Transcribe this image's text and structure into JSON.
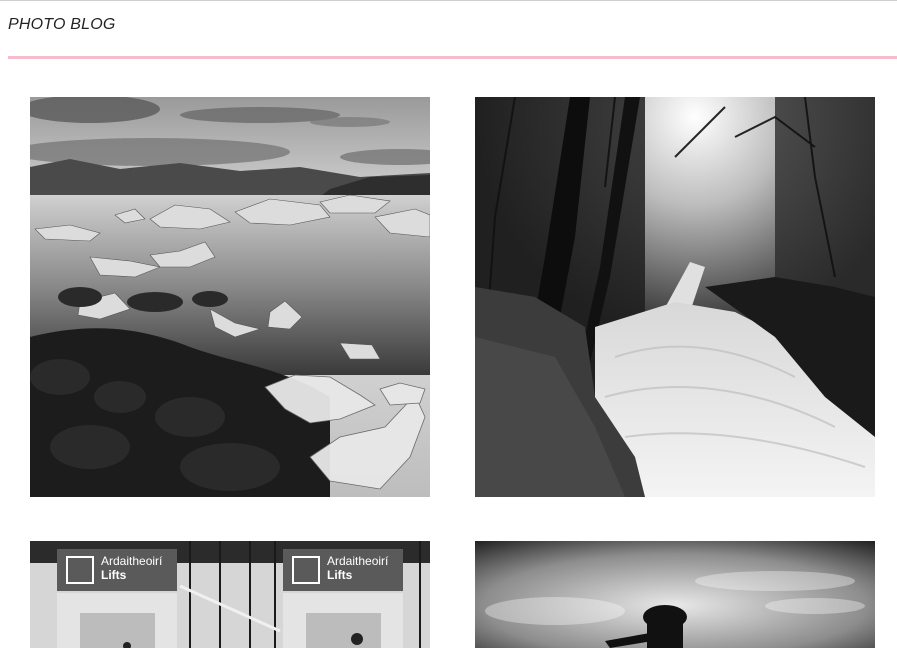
{
  "site": {
    "title": "PHOTO BLOG",
    "accent_color": "#f7bccb"
  },
  "gallery": {
    "photos": [
      {
        "subject": "glacier-lagoon"
      },
      {
        "subject": "forest-waterfall"
      },
      {
        "subject": "airport-lifts",
        "signs": [
          {
            "line1": "Ardaitheoirí",
            "line2": "Lifts"
          },
          {
            "line1": "Ardaitheoirí",
            "line2": "Lifts"
          }
        ]
      },
      {
        "subject": "cyclist-silhouette"
      }
    ]
  }
}
